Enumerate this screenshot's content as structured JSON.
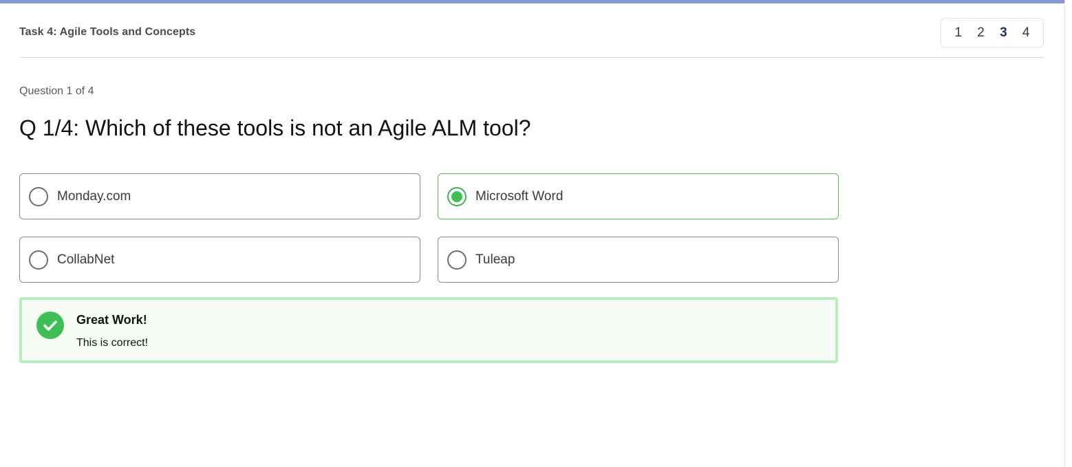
{
  "header": {
    "task_title": "Task 4: Agile Tools and Concepts",
    "pages": [
      "1",
      "2",
      "3",
      "4"
    ],
    "active_page": "3"
  },
  "question": {
    "counter": "Question 1 of 4",
    "title": "Q 1/4: Which of these tools is not an Agile ALM tool?",
    "options": [
      {
        "label": "Monday.com",
        "selected": false
      },
      {
        "label": "Microsoft Word",
        "selected": true
      },
      {
        "label": "CollabNet",
        "selected": false
      },
      {
        "label": "Tuleap",
        "selected": false
      }
    ]
  },
  "feedback": {
    "title": "Great Work!",
    "text": "This is correct!",
    "icon": "check-circle-icon"
  },
  "colors": {
    "top_bar": "#8798d0",
    "success": "#3ebf55",
    "success_border": "#b6eec0",
    "active_page": "#1a2c7a"
  }
}
